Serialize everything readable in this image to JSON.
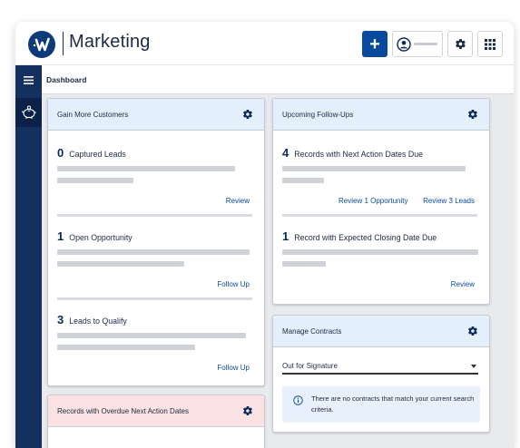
{
  "app": {
    "title": "Marketing"
  },
  "colors": {
    "brand_navy": "#13305f",
    "primary_blue": "#0a4a9e",
    "card_header": "#e3effb",
    "alert_header": "#fbe2e2"
  },
  "header": {
    "add_icon": "plus-icon",
    "user_icon": "user-circle-icon",
    "settings_icon": "gear-icon",
    "apps_icon": "grid-icon"
  },
  "sidebar": {
    "menu_icon": "hamburger-icon",
    "items": [
      {
        "icon": "piggy-bank-icon"
      }
    ]
  },
  "breadcrumb": {
    "label": "Dashboard"
  },
  "cards": {
    "gain": {
      "title": "Gain More Customers",
      "metrics": [
        {
          "count": "0",
          "label": "Captured Leads",
          "link": "Review"
        },
        {
          "count": "1",
          "label": "Open Opportunity",
          "link": "Follow Up"
        },
        {
          "count": "3",
          "label": "Leads to Qualify",
          "link": "Follow Up"
        }
      ]
    },
    "followups": {
      "title": "Upcoming Follow-Ups",
      "metrics": [
        {
          "count": "4",
          "label": "Records with Next Action Dates Due",
          "link1": "Review 1 Opportunity",
          "link2": "Review 3 Leads"
        },
        {
          "count": "1",
          "label": "Record with Expected Closing Date Due",
          "link": "Review"
        }
      ]
    },
    "contracts": {
      "title": "Manage Contracts",
      "select_value": "Out for Signature",
      "info": "There are no contracts that match your current search criteria."
    },
    "overdue": {
      "title": "Records with Overdue Next Action Dates"
    }
  }
}
